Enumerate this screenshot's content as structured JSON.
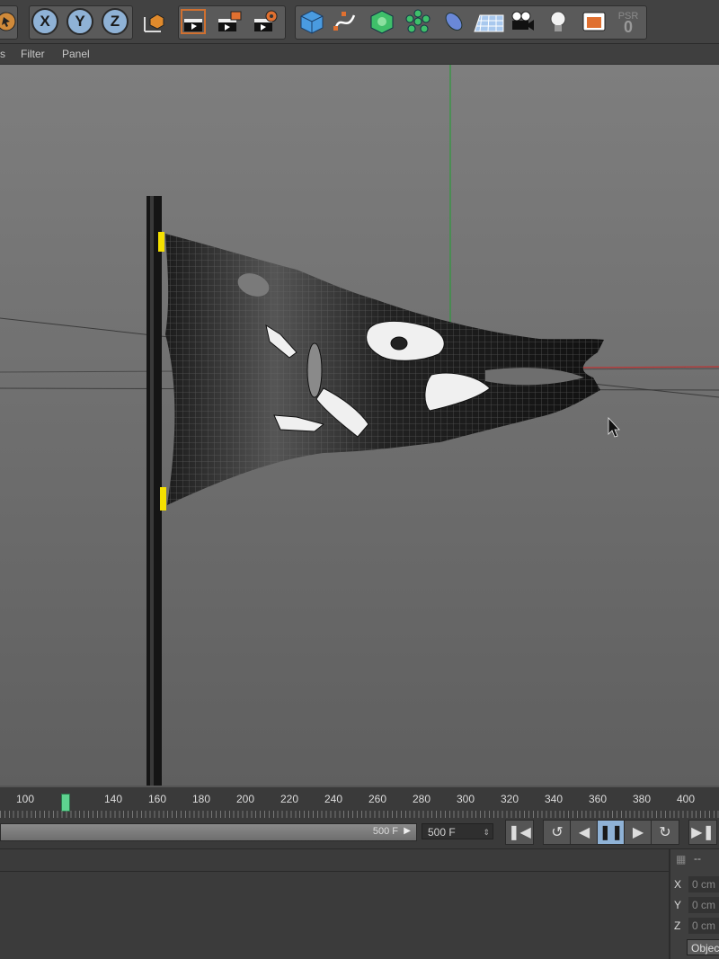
{
  "toolbar": {
    "axis_x": "X",
    "axis_y": "Y",
    "axis_z": "Z",
    "psr_label": "PSR",
    "psr_value": "0",
    "icons": [
      "move-icon",
      "x-axis-icon",
      "y-axis-icon",
      "z-axis-icon",
      "world-coord-icon",
      "render-view-icon",
      "render-picture-viewer-icon",
      "render-settings-icon",
      "cube-icon",
      "spline-pen-icon",
      "subdivision-icon",
      "cloner-icon",
      "deformer-icon",
      "floor-icon",
      "camera-icon",
      "light-icon",
      "scene-icon",
      "psr-icon"
    ]
  },
  "menu": {
    "item_0": "s",
    "filter": "Filter",
    "panel": "Panel"
  },
  "timeline": {
    "ticks": [
      "100",
      "140",
      "160",
      "180",
      "200",
      "220",
      "240",
      "260",
      "280",
      "300",
      "320",
      "340",
      "360",
      "380",
      "400"
    ],
    "playhead_frame": "120"
  },
  "transport": {
    "slider_label": "500 F",
    "end_frame": "500 F",
    "buttons": [
      "go-to-start",
      "loop",
      "play-backwards",
      "pause",
      "play-forwards",
      "loop-end",
      "go-to-end"
    ]
  },
  "coords": {
    "header": "--",
    "x_label": "X",
    "y_label": "Y",
    "z_label": "Z",
    "x_value": "0 cm",
    "y_value": "0 cm",
    "z_value": "0 cm",
    "object_button": "Objec"
  }
}
